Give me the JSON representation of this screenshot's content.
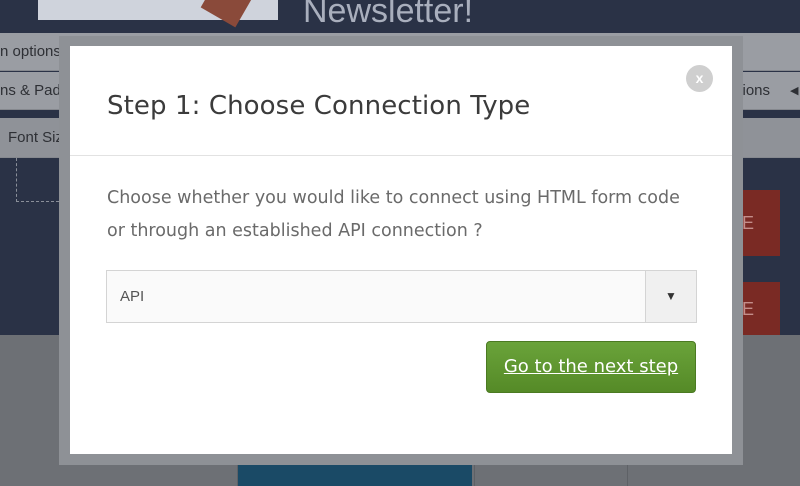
{
  "background": {
    "hero_title": "Newsletter!",
    "toolbar_1_left": "n options",
    "toolbar_2_left": "ns & Pad",
    "toolbar_2_right": "sions",
    "toolbar_3_left": "Font Siz",
    "red_button_1": "E",
    "red_button_2": "E"
  },
  "modal": {
    "title": "Step 1: Choose Connection Type",
    "close_label": "x",
    "description": "Choose whether you would like to connect using HTML form code or through an established API connection ?",
    "select": {
      "value": "API",
      "arrow": "▼"
    },
    "next_button_label": "Go to the next step"
  },
  "colors": {
    "primary_button": "#5e9a2d",
    "overlay": "#6b6e73"
  },
  "icons": {
    "close": "close-icon",
    "dropdown": "triangle-down-icon"
  }
}
